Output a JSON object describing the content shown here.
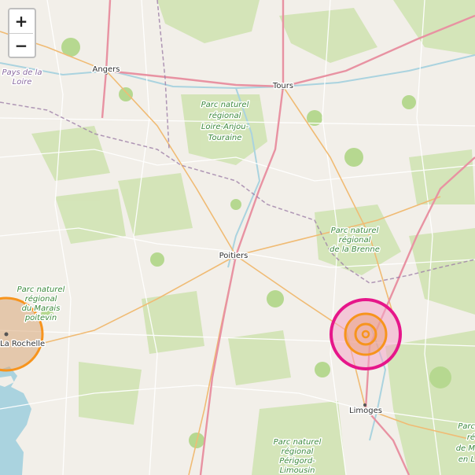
{
  "controls": {
    "zoom_in": "+",
    "zoom_out": "−"
  },
  "cities": {
    "angers": "Angers",
    "tours": "Tours",
    "poitiers": "Poitiers",
    "la_rochelle": "La Rochelle",
    "limoges": "Limoges"
  },
  "regions": {
    "pays_de_la_loire": [
      "Pays de la",
      "Loire"
    ]
  },
  "parks": {
    "loire_anjou": [
      "Parc naturel",
      "régional",
      "Loire-Anjou-",
      "Touraine"
    ],
    "brenne": [
      "Parc naturel",
      "régional",
      "de la Brenne"
    ],
    "marais": [
      "Parc naturel",
      "régional",
      "du Marais",
      "poitevin"
    ],
    "perigord": [
      "Parc naturel",
      "régional",
      "Périgord-",
      "Limousin"
    ],
    "millevaches": [
      "Parc",
      "ré",
      "de M",
      "en L"
    ]
  },
  "markers": {
    "east_circle_colors": {
      "outer_fill": "#f4a6c8",
      "outer_stroke": "#e6168a",
      "inner_stroke": "#f7941d"
    },
    "west_circle_colors": {
      "fill": "#d9a77a",
      "stroke": "#f7941d"
    }
  },
  "colors": {
    "land": "#f2efe9",
    "forest": "#c8e0a8",
    "water": "#aad3df",
    "motorway": "#e892a2",
    "primary": "#fcd6a4",
    "minor": "#ffffff",
    "border": "#9e7fa8"
  }
}
